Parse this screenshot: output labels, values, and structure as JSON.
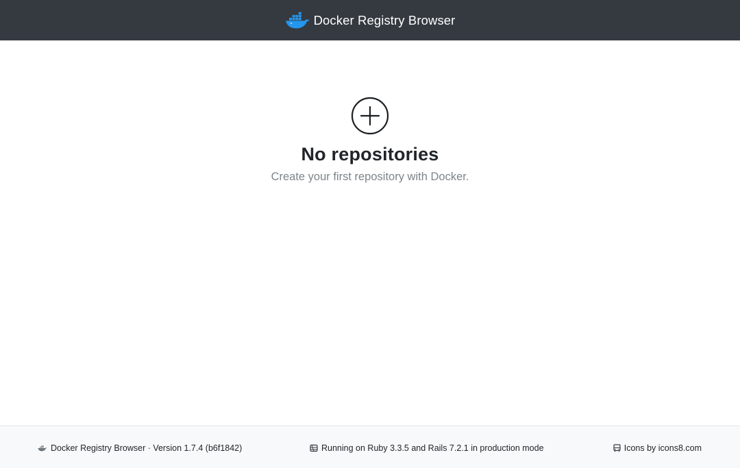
{
  "navbar": {
    "brand_icon": "docker-whale-icon",
    "title": "Docker Registry Browser",
    "colors": {
      "background": "#343a40",
      "logo": "#2496ed"
    }
  },
  "empty_state": {
    "icon": "plus-circle-icon",
    "title": "No repositories",
    "subtitle": "Create your first repository with Docker."
  },
  "footer": {
    "app_icon": "docker-whale-icon",
    "version_text": "Docker Registry Browser · Version 1.7.4 (b6f1842)",
    "runtime_icon": "server-icon",
    "runtime_text": "Running on Ruby 3.3.5 and Rails 7.2.1 in production mode",
    "credits_icon": "bus-icon",
    "credits_text": "Icons by icons8.com"
  }
}
